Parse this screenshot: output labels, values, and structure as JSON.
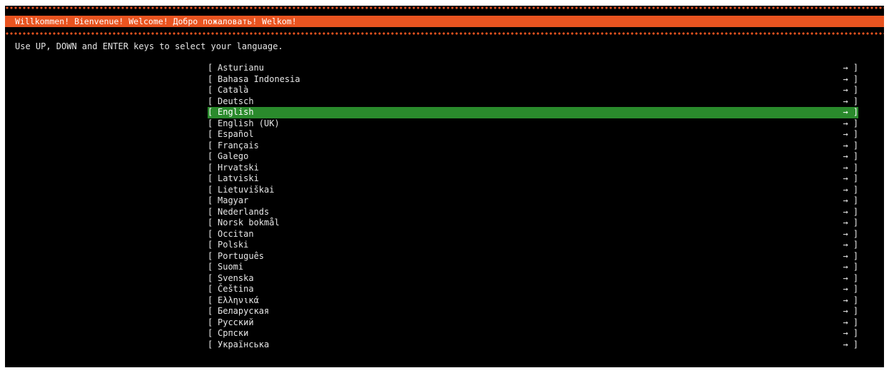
{
  "header": {
    "title": "Willkommen! Bienvenue! Welcome! Добро пожаловать! Welkom!"
  },
  "instruction": "Use UP, DOWN and ENTER keys to select your language.",
  "list": {
    "open_bracket": "[",
    "close_marker": "→ ]",
    "selected_index": 4,
    "items": [
      "Asturianu",
      "Bahasa Indonesia",
      "Català",
      "Deutsch",
      "English",
      "English (UK)",
      "Español",
      "Français",
      "Galego",
      "Hrvatski",
      "Latviski",
      "Lietuviškai",
      "Magyar",
      "Nederlands",
      "Norsk bokmål",
      "Occitan",
      "Polski",
      "Português",
      "Suomi",
      "Svenska",
      "Čeština",
      "Ελληνικά",
      "Беларуская",
      "Русский",
      "Српски",
      "Українська"
    ]
  },
  "colors": {
    "header_bg": "#e95420",
    "selected_bg": "#2a8a2c",
    "screen_bg": "#000000",
    "text": "#e6e6e6"
  }
}
